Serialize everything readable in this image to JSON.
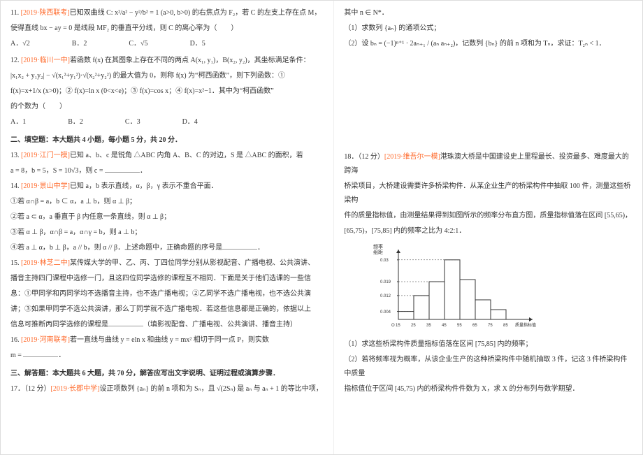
{
  "left": {
    "q11": {
      "tag": "[2019·陕西联考]",
      "pre": "11. ",
      "body1": "已知双曲线 C: x²/a² − y²/b² = 1 (a>0, b>0) 的右焦点为 F₂，若 C 的左支上存在点 M，",
      "body2": "使得直线 bx − ay = 0 是线段 MF₂ 的垂直平分线，则 C 的离心率为（　　）",
      "opts": {
        "a": "A．√2",
        "b": "B．2",
        "c": "C．√5",
        "d": "D．5"
      }
    },
    "q12": {
      "tag": "[2019·临川一中]",
      "pre": "12. ",
      "body1": "若函数 f(x) 在其图象上存在不同的两点 A(x₁, y₁)，B(x₂, y₂)，其坐标满足条件：",
      "body2": "|x₁x₂ + y₁y₂| − √(x₁²+y₁²)·√(x₂²+y₂²) 的最大值为 0，则称 f(x) 为“柯西函数”，则下列函数：①",
      "body3": "f(x)=x+1/x (x>0)；② f(x)=ln x (0<x<e)；③ f(x)=cos x；④ f(x)=x²−1．其中为“柯西函数”",
      "body4": "的个数为（　　）",
      "opts": {
        "a": "A．1",
        "b": "B．2",
        "c": "C．3",
        "d": "D．4"
      }
    },
    "section2": "二、填空题：本大题共 4 小题，每小题 5 分，共 20 分．",
    "q13": {
      "tag": "[2019·江门一模]",
      "pre": "13. ",
      "body1": "已知 a、b、c 是锐角 △ABC 内角 A、B、C 的对边，S 是 △ABC 的面积，若",
      "body2": "a = 8，b = 5，S = 10√3，则 c = "
    },
    "q14": {
      "tag": "[2019·景山中学]",
      "pre": "14. ",
      "body1": "已知 a，b 表示直线，α，β，γ 表示不重合平面．",
      "l1": "①若 α∩β = a，b ⊂ α，a ⊥ b，则 α ⊥ β；",
      "l2": "②若 a ⊂ α，a 垂直于 β 内任意一条直线，则 α ⊥ β；",
      "l3": "③若 α ⊥ β，α∩β = a，α∩γ = b，则 a ⊥ b；",
      "l4": "④若 a ⊥ α，b ⊥ β，a // b，则 α // β．上述命题中，正确命题的序号是"
    },
    "q15": {
      "tag": "[2019·林芝二中]",
      "pre": "15. ",
      "body1": "某传媒大学的甲、乙、丙、丁四位同学分别从影视配音、广播电视、公共演讲、",
      "body2": "播音主持四门课程中选修一门，且这四位同学选修的课程互不相同．下面是关于他们选课的一些信",
      "body3": "息：①甲同学和丙同学均不选播音主持，也不选广播电视；②乙同学不选广播电视，也不选公共演",
      "body4": "讲；③如果甲同学不选公共演讲，那么丁同学就不选广播电视．若这些信息都是正确的，依据以上",
      "body5": "信息可推断丙同学选修的课程是",
      "tail": "（填影视配音、广播电视、公共演讲、播音主持）"
    },
    "q16": {
      "tag": "[2019·河南联考]",
      "pre": "16. ",
      "body1": "若一直线与曲线 y = eln x 和曲线 y = mx² 相切于同一点 P，则实数",
      "body2": "m = "
    },
    "section3": "三、解答题：本大题共 6 大题，共 70 分，解答应写出文字说明、证明过程或演算步骤．",
    "q17": {
      "tag": "[2019·长郡中学]",
      "pre": "17．（12 分）",
      "body1": "设正项数列 {aₙ} 的前 n 项和为 Sₙ，且 √(2Sₙ) 是 aₙ 与 aₙ + 1 的等比中项，"
    }
  },
  "right": {
    "q17c": {
      "l1": "其中 n ∈ N*．",
      "l2": "（1）求数列 {aₙ} 的通项公式；",
      "l3": "（2）设 bₙ = (−1)ⁿ⁺¹ · 2aₙ₊₁ / (aₙ aₙ₊₂)，记数列 {bₙ} 的前 n 项和为 Tₙ，求证：T₂ₙ < 1．"
    },
    "q18": {
      "tag": "[2019·维吾尔一模]",
      "pre": "18．（12 分）",
      "body1": "港珠澳大桥是中国建设史上里程最长、投资最多、难度最大的跨海",
      "body2": "桥梁项目，大桥建设需要许多桥梁构件．从某企业生产的桥梁构件中抽取 100 件，测量这些桥梁构",
      "body3": "件的质量指标值，由测量结果得到如图所示的频率分布直方图，质量指标值落在区间 [55,65)，",
      "body4": "[65,75)，[75,85] 内的频率之比为 4:2:1．",
      "sub1": "（1）求这些桥梁构件质量指标值落在区间 [75,85] 内的频率；",
      "sub2": "（2）若将频率视为概率，从该企业生产的这种桥梁构件中随机抽取 3 件，记这 3 件桥梁构件中质量",
      "sub3": "指标值位于区间 [45,75) 内的桥梁构件件数为 X，求 X 的分布列与数学期望．"
    }
  },
  "chart_data": {
    "type": "bar",
    "title": "",
    "xlabel": "质量指标值",
    "ylabel": "频率/组距",
    "categories": [
      "[15,25)",
      "[25,35)",
      "[35,45)",
      "[45,55)",
      "[55,65)",
      "[65,75)",
      "[75,85]"
    ],
    "x_ticks": [
      15,
      25,
      35,
      45,
      55,
      65,
      75,
      85
    ],
    "values": [
      0.004,
      0.012,
      0.019,
      0.03,
      null,
      null,
      null
    ],
    "y_ticks": [
      0.004,
      0.012,
      0.019,
      0.03
    ],
    "ylim": [
      0,
      0.034
    ],
    "note": "last three bar heights drawn but unlabeled on y-axis; values implied by 4:2:1 ratio in problem text"
  }
}
